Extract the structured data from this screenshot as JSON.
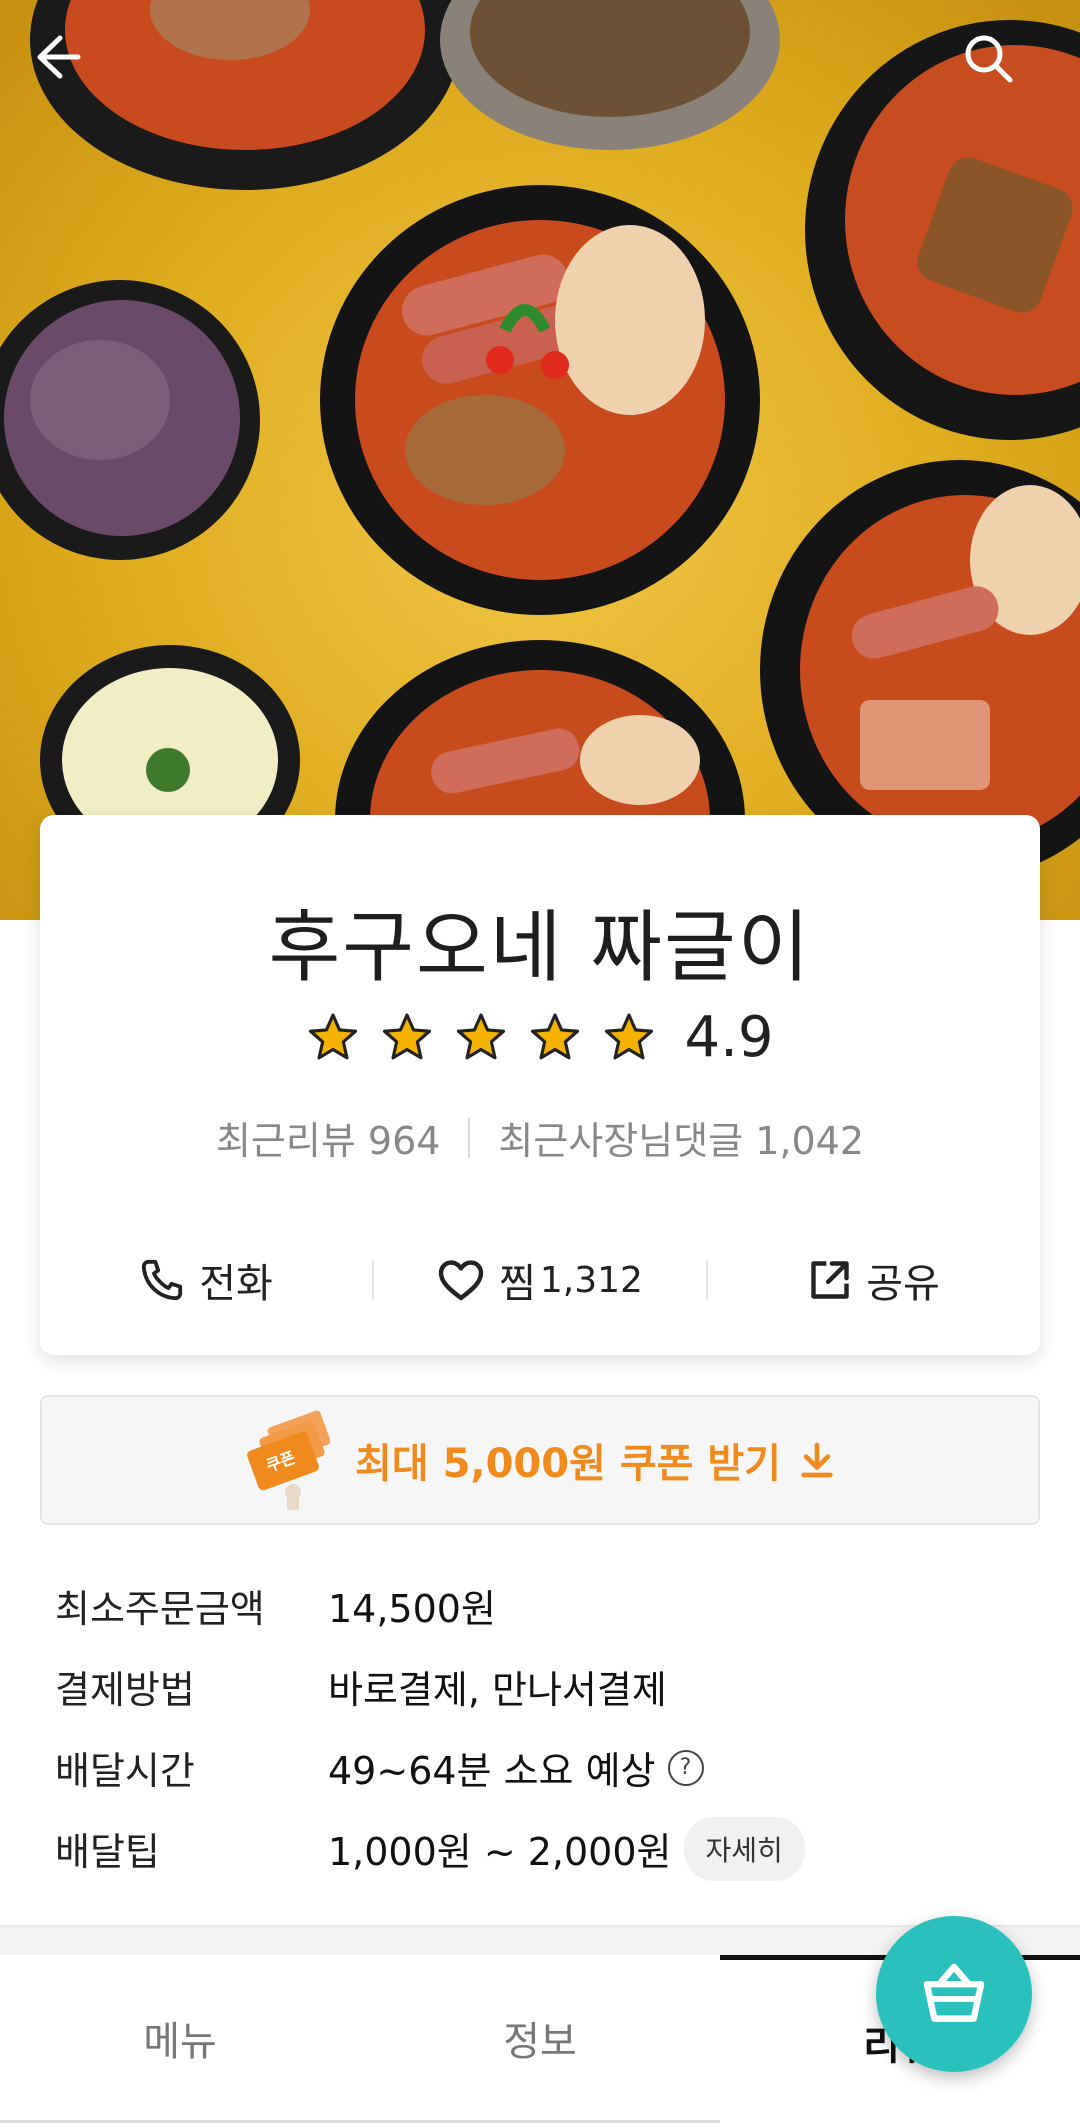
{
  "header": {
    "back_icon": "arrow-left-icon",
    "search_icon": "search-icon"
  },
  "store": {
    "name": "후구오네 짜글이",
    "rating": "4.9",
    "stars": 5,
    "star_color": "#f5b300",
    "recent_reviews": "최근리뷰 964",
    "recent_owner_replies": "최근사장님댓글 1,042"
  },
  "actions": {
    "call_label": "전화",
    "like_label": "찜",
    "like_count": "1,312",
    "share_label": "공유"
  },
  "coupon": {
    "badge": "쿠폰",
    "label": "최대 5,000원 쿠폰 받기",
    "accent": "#f08a1c"
  },
  "info": {
    "min_order_label": "최소주문금액",
    "min_order_value": "14,500원",
    "payment_label": "결제방법",
    "payment_value": "바로결제, 만나서결제",
    "delivery_time_label": "배달시간",
    "delivery_time_value": "49~64분 소요 예상",
    "delivery_tip_label": "배달팁",
    "delivery_tip_value": "1,000원 ~ 2,000원",
    "detail_button": "자세히"
  },
  "tabs": [
    {
      "label": "메뉴"
    },
    {
      "label": "정보"
    },
    {
      "label": "리뷰"
    }
  ],
  "cart": {
    "icon": "basket-icon",
    "color": "#2ac1bc"
  }
}
